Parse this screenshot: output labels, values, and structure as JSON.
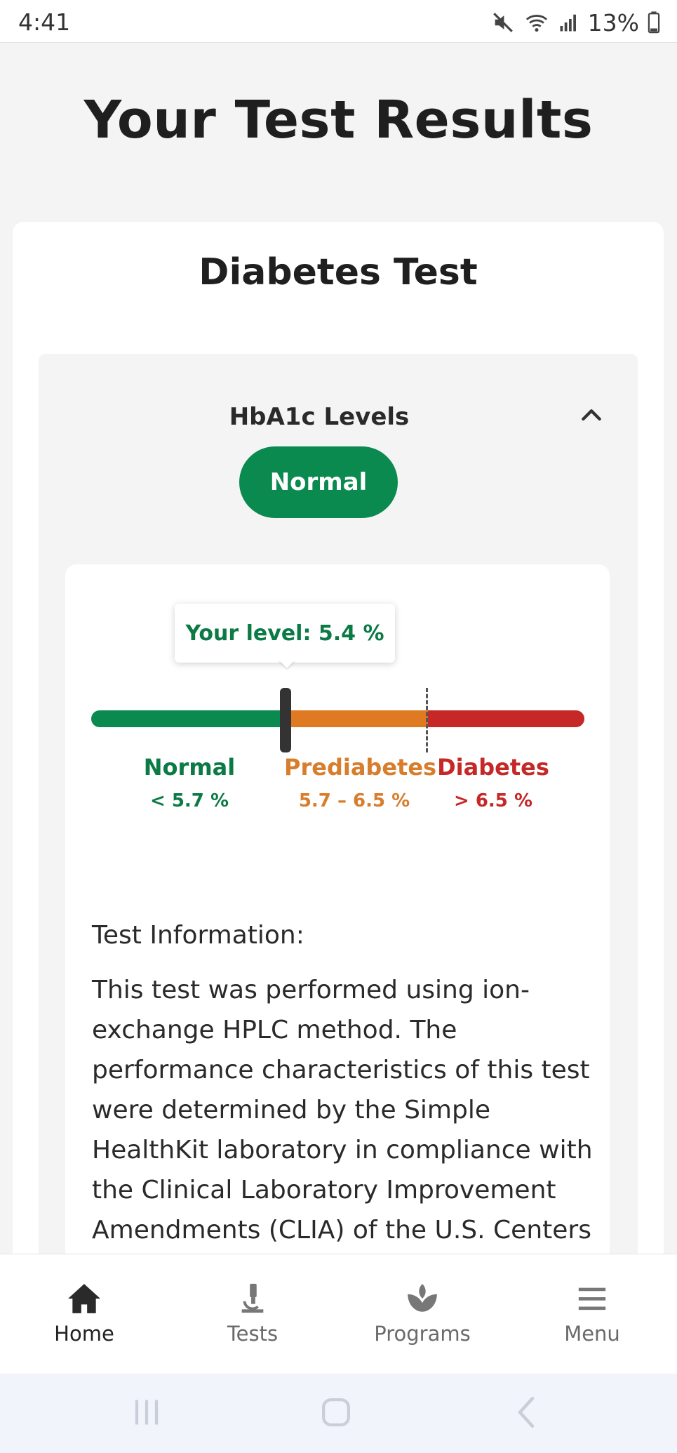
{
  "status_bar": {
    "time": "4:41",
    "battery": "13%"
  },
  "page": {
    "title": "Your Test Results"
  },
  "card": {
    "title": "Diabetes Test",
    "section": {
      "title": "HbA1c Levels",
      "status": "Normal",
      "level_label": "Your level: 5.4 %",
      "level_value": 5.4,
      "ranges": [
        {
          "name": "Normal",
          "range": "< 5.7 %"
        },
        {
          "name": "Prediabetes",
          "range": "5.7 – 6.5 %"
        },
        {
          "name": "Diabetes",
          "range": "> 6.5 %"
        }
      ],
      "info_label": "Test Information:",
      "info_text": "This test was performed using ion-exchange HPLC method. The performance characteristics of this test were determined by the Simple HealthKit laboratory in compliance with the Clinical Laboratory Improvement Amendments (CLIA) of the U.S. Centers"
    }
  },
  "nav": {
    "items": [
      {
        "label": "Home",
        "icon": "home-icon"
      },
      {
        "label": "Tests",
        "icon": "microscope-icon"
      },
      {
        "label": "Programs",
        "icon": "leaf-icon"
      },
      {
        "label": "Menu",
        "icon": "menu-icon"
      }
    ]
  },
  "colors": {
    "normal": "#0b8a4f",
    "prediabetes": "#e07a22",
    "diabetes": "#c62828"
  }
}
